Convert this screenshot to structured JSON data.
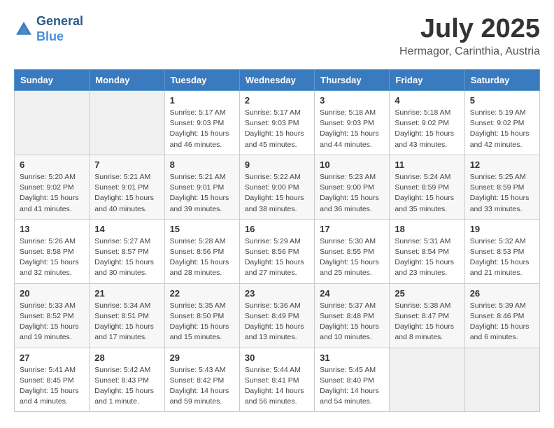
{
  "header": {
    "logo_line1": "General",
    "logo_line2": "Blue",
    "month": "July 2025",
    "location": "Hermagor, Carinthia, Austria"
  },
  "weekdays": [
    "Sunday",
    "Monday",
    "Tuesday",
    "Wednesday",
    "Thursday",
    "Friday",
    "Saturday"
  ],
  "weeks": [
    [
      {
        "day": "",
        "sunrise": "",
        "sunset": "",
        "daylight": ""
      },
      {
        "day": "",
        "sunrise": "",
        "sunset": "",
        "daylight": ""
      },
      {
        "day": "1",
        "sunrise": "Sunrise: 5:17 AM",
        "sunset": "Sunset: 9:03 PM",
        "daylight": "Daylight: 15 hours and 46 minutes."
      },
      {
        "day": "2",
        "sunrise": "Sunrise: 5:17 AM",
        "sunset": "Sunset: 9:03 PM",
        "daylight": "Daylight: 15 hours and 45 minutes."
      },
      {
        "day": "3",
        "sunrise": "Sunrise: 5:18 AM",
        "sunset": "Sunset: 9:03 PM",
        "daylight": "Daylight: 15 hours and 44 minutes."
      },
      {
        "day": "4",
        "sunrise": "Sunrise: 5:18 AM",
        "sunset": "Sunset: 9:02 PM",
        "daylight": "Daylight: 15 hours and 43 minutes."
      },
      {
        "day": "5",
        "sunrise": "Sunrise: 5:19 AM",
        "sunset": "Sunset: 9:02 PM",
        "daylight": "Daylight: 15 hours and 42 minutes."
      }
    ],
    [
      {
        "day": "6",
        "sunrise": "Sunrise: 5:20 AM",
        "sunset": "Sunset: 9:02 PM",
        "daylight": "Daylight: 15 hours and 41 minutes."
      },
      {
        "day": "7",
        "sunrise": "Sunrise: 5:21 AM",
        "sunset": "Sunset: 9:01 PM",
        "daylight": "Daylight: 15 hours and 40 minutes."
      },
      {
        "day": "8",
        "sunrise": "Sunrise: 5:21 AM",
        "sunset": "Sunset: 9:01 PM",
        "daylight": "Daylight: 15 hours and 39 minutes."
      },
      {
        "day": "9",
        "sunrise": "Sunrise: 5:22 AM",
        "sunset": "Sunset: 9:00 PM",
        "daylight": "Daylight: 15 hours and 38 minutes."
      },
      {
        "day": "10",
        "sunrise": "Sunrise: 5:23 AM",
        "sunset": "Sunset: 9:00 PM",
        "daylight": "Daylight: 15 hours and 36 minutes."
      },
      {
        "day": "11",
        "sunrise": "Sunrise: 5:24 AM",
        "sunset": "Sunset: 8:59 PM",
        "daylight": "Daylight: 15 hours and 35 minutes."
      },
      {
        "day": "12",
        "sunrise": "Sunrise: 5:25 AM",
        "sunset": "Sunset: 8:59 PM",
        "daylight": "Daylight: 15 hours and 33 minutes."
      }
    ],
    [
      {
        "day": "13",
        "sunrise": "Sunrise: 5:26 AM",
        "sunset": "Sunset: 8:58 PM",
        "daylight": "Daylight: 15 hours and 32 minutes."
      },
      {
        "day": "14",
        "sunrise": "Sunrise: 5:27 AM",
        "sunset": "Sunset: 8:57 PM",
        "daylight": "Daylight: 15 hours and 30 minutes."
      },
      {
        "day": "15",
        "sunrise": "Sunrise: 5:28 AM",
        "sunset": "Sunset: 8:56 PM",
        "daylight": "Daylight: 15 hours and 28 minutes."
      },
      {
        "day": "16",
        "sunrise": "Sunrise: 5:29 AM",
        "sunset": "Sunset: 8:56 PM",
        "daylight": "Daylight: 15 hours and 27 minutes."
      },
      {
        "day": "17",
        "sunrise": "Sunrise: 5:30 AM",
        "sunset": "Sunset: 8:55 PM",
        "daylight": "Daylight: 15 hours and 25 minutes."
      },
      {
        "day": "18",
        "sunrise": "Sunrise: 5:31 AM",
        "sunset": "Sunset: 8:54 PM",
        "daylight": "Daylight: 15 hours and 23 minutes."
      },
      {
        "day": "19",
        "sunrise": "Sunrise: 5:32 AM",
        "sunset": "Sunset: 8:53 PM",
        "daylight": "Daylight: 15 hours and 21 minutes."
      }
    ],
    [
      {
        "day": "20",
        "sunrise": "Sunrise: 5:33 AM",
        "sunset": "Sunset: 8:52 PM",
        "daylight": "Daylight: 15 hours and 19 minutes."
      },
      {
        "day": "21",
        "sunrise": "Sunrise: 5:34 AM",
        "sunset": "Sunset: 8:51 PM",
        "daylight": "Daylight: 15 hours and 17 minutes."
      },
      {
        "day": "22",
        "sunrise": "Sunrise: 5:35 AM",
        "sunset": "Sunset: 8:50 PM",
        "daylight": "Daylight: 15 hours and 15 minutes."
      },
      {
        "day": "23",
        "sunrise": "Sunrise: 5:36 AM",
        "sunset": "Sunset: 8:49 PM",
        "daylight": "Daylight: 15 hours and 13 minutes."
      },
      {
        "day": "24",
        "sunrise": "Sunrise: 5:37 AM",
        "sunset": "Sunset: 8:48 PM",
        "daylight": "Daylight: 15 hours and 10 minutes."
      },
      {
        "day": "25",
        "sunrise": "Sunrise: 5:38 AM",
        "sunset": "Sunset: 8:47 PM",
        "daylight": "Daylight: 15 hours and 8 minutes."
      },
      {
        "day": "26",
        "sunrise": "Sunrise: 5:39 AM",
        "sunset": "Sunset: 8:46 PM",
        "daylight": "Daylight: 15 hours and 6 minutes."
      }
    ],
    [
      {
        "day": "27",
        "sunrise": "Sunrise: 5:41 AM",
        "sunset": "Sunset: 8:45 PM",
        "daylight": "Daylight: 15 hours and 4 minutes."
      },
      {
        "day": "28",
        "sunrise": "Sunrise: 5:42 AM",
        "sunset": "Sunset: 8:43 PM",
        "daylight": "Daylight: 15 hours and 1 minute."
      },
      {
        "day": "29",
        "sunrise": "Sunrise: 5:43 AM",
        "sunset": "Sunset: 8:42 PM",
        "daylight": "Daylight: 14 hours and 59 minutes."
      },
      {
        "day": "30",
        "sunrise": "Sunrise: 5:44 AM",
        "sunset": "Sunset: 8:41 PM",
        "daylight": "Daylight: 14 hours and 56 minutes."
      },
      {
        "day": "31",
        "sunrise": "Sunrise: 5:45 AM",
        "sunset": "Sunset: 8:40 PM",
        "daylight": "Daylight: 14 hours and 54 minutes."
      },
      {
        "day": "",
        "sunrise": "",
        "sunset": "",
        "daylight": ""
      },
      {
        "day": "",
        "sunrise": "",
        "sunset": "",
        "daylight": ""
      }
    ]
  ]
}
